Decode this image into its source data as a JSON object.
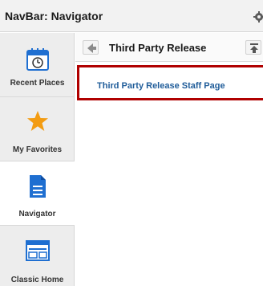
{
  "header": {
    "title": "NavBar: Navigator",
    "settings_icon": "gear-icon"
  },
  "sidebar": {
    "items": [
      {
        "label": "Recent Places",
        "icon": "calendar-clock-icon",
        "active": false
      },
      {
        "label": "My Favorites",
        "icon": "star-icon",
        "active": false
      },
      {
        "label": "Navigator",
        "icon": "document-icon",
        "active": true
      },
      {
        "label": "Classic Home",
        "icon": "window-icon",
        "active": false
      }
    ]
  },
  "main": {
    "title": "Third Party Release",
    "links": [
      {
        "label": "Third Party Release Staff Page"
      }
    ]
  },
  "colors": {
    "link": "#1f5c99",
    "highlight_border": "#b00000",
    "icon_blue": "#1f6fd1",
    "star": "#f39c12"
  }
}
